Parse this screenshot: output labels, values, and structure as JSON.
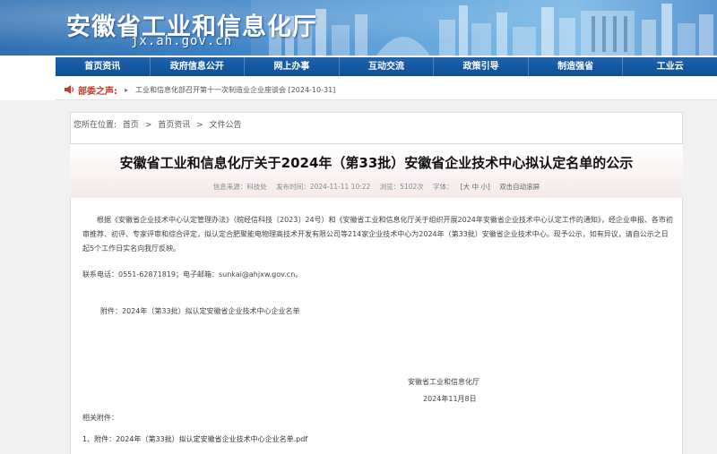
{
  "header": {
    "site_title": "安徽省工业和信息化厅",
    "site_domain": "jx.ah.gov.cn"
  },
  "nav": {
    "items": [
      "首页资讯",
      "政府信息公开",
      "网上办事",
      "互动交流",
      "政策引导",
      "制造强省",
      "工业云"
    ]
  },
  "ticker": {
    "label": "部委之声:",
    "text": "工业和信息化部召开第十一次制造业企业座谈会 [2024-10-31]"
  },
  "breadcrumb": {
    "prefix": "您所在位置:",
    "items": [
      "首页",
      "首页资讯",
      "文件公告"
    ],
    "separator": ">"
  },
  "article": {
    "title": "安徽省工业和信息化厅关于2024年（第33批）安徽省企业技术中心拟认定名单的公示",
    "meta": {
      "source": "信息来源：科技处",
      "date": "发布时间：2024-11-11 10:22",
      "views": "浏览：5102次",
      "font_label": "字体：",
      "font_sizes": "[大 中 小]",
      "scroll": "双击自动滚屏"
    },
    "paragraph1": "根据《安徽省企业技术中心认定管理办法》（皖经信科技〔2023〕24号）和《安徽省工业和信息化厅关于组织开展2024年安徽省企业技术中心认定工作的通知》，经企业申报、各市初审推荐、初评、专家评审和综合评定，拟认定合肥聚能电物理高技术开发有限公司等214家企业技术中心为2024年（第33批）安徽省企业技术中心。现予公示，如有异议，请自公示之日起5个工作日实名向我厅反映。",
    "contact": "联系电话：0551-62871819；电子邮箱：sunkai@ahjxw.gov.cn。",
    "attachment": "附件：2024年（第33批）拟认定安徽省企业技术中心企业名单",
    "signature_org": "安徽省工业和信息化厅",
    "signature_date": "2024年11月8日",
    "related_heading": "相关附件：",
    "related_files": [
      "1、附件：2024年（第33批）拟认定安徽省企业技术中心企业名单.pdf"
    ]
  },
  "colors": {
    "nav_bg": "#1a5ca3",
    "ticker_label": "#c23b2e",
    "page_bg": "#f1f1f1"
  }
}
